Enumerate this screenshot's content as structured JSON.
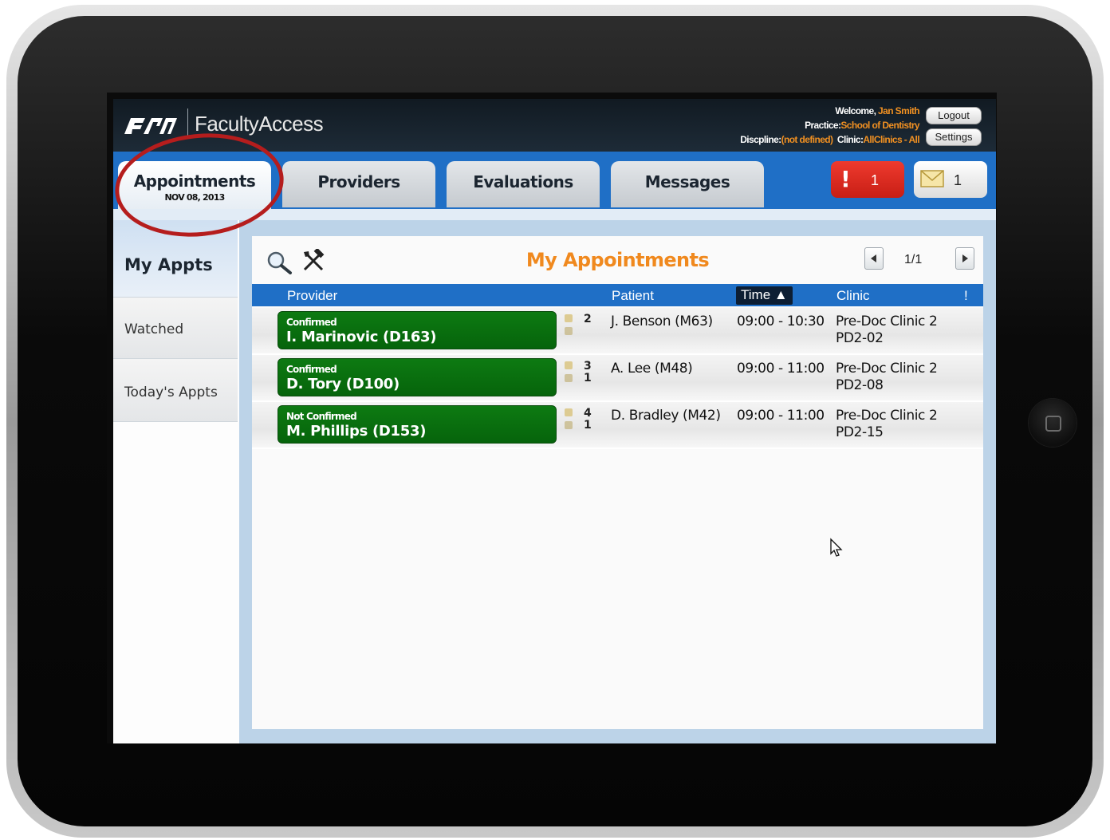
{
  "header": {
    "app_title": "FacultyAccess",
    "welcome_label": "Welcome,",
    "welcome_value": "Jan Smith",
    "practice_label": "Practice:",
    "practice_value": "School of Dentistry",
    "discipline_label": "Discpline:",
    "discipline_value": "(not defined)",
    "clinic_label": "Clinic:",
    "clinic_value": "AllClinics - All",
    "logout_label": "Logout",
    "settings_label": "Settings"
  },
  "tabs": [
    {
      "label": "Appointments",
      "sublabel": "NOV 08, 2013"
    },
    {
      "label": "Providers"
    },
    {
      "label": "Evaluations"
    },
    {
      "label": "Messages"
    }
  ],
  "alerts": {
    "icon": "exclamation-icon",
    "count": "1"
  },
  "messages": {
    "icon": "envelope-icon",
    "count": "1"
  },
  "sidebar": {
    "items": [
      {
        "label": "My Appts"
      },
      {
        "label": "Watched"
      },
      {
        "label": "Today's Appts"
      }
    ]
  },
  "main": {
    "title": "My Appointments",
    "pagination": "1/1",
    "columns": {
      "provider": "Provider",
      "patient": "Patient",
      "time": "Time ▲",
      "clinic": "Clinic",
      "flag": "!"
    },
    "rows": [
      {
        "status": "Confirmed",
        "provider": "I. Marinovic (D163)",
        "count1": "2",
        "count2": "",
        "patient": "J. Benson (M63)",
        "time": "09:00 - 10:30",
        "clinic": "Pre-Doc Clinic 2",
        "chair": "PD2-02"
      },
      {
        "status": "Confirmed",
        "provider": "D. Tory (D100)",
        "count1": "3",
        "count2": "1",
        "patient": "A. Lee (M48)",
        "time": "09:00 - 11:00",
        "clinic": "Pre-Doc Clinic 2",
        "chair": "PD2-08"
      },
      {
        "status": "Not Confirmed",
        "provider": "M. Phillips (D153)",
        "count1": "4",
        "count2": "1",
        "patient": "D. Bradley (M42)",
        "time": "09:00 - 11:00",
        "clinic": "Pre-Doc Clinic 2",
        "chair": "PD2-15"
      }
    ]
  },
  "colors": {
    "accent_blue": "#1f6fc6",
    "title_orange": "#f0891e",
    "provider_green": "#0d7a12",
    "alert_red": "#e0281f",
    "annotation_red": "#b51d1d"
  }
}
